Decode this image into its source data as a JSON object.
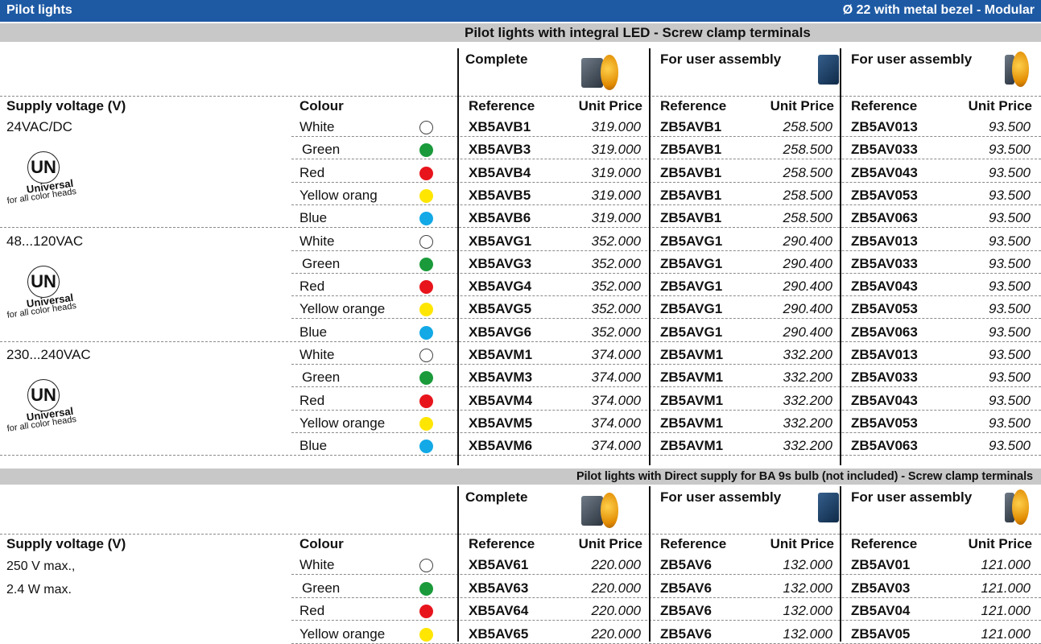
{
  "header": {
    "left": "Pilot lights",
    "right": "Ø 22 with metal bezel - Modular"
  },
  "section1": {
    "title": "Pilot lights with integral LED - Screw clamp terminals",
    "groups": [
      "Complete",
      "For user assembly",
      "For user assembly"
    ],
    "col_headers": {
      "supply": "Supply voltage (V)",
      "colour": "Colour",
      "reference": "Reference",
      "unit_price": "Unit Price"
    },
    "supply_blocks": [
      {
        "voltage": "24VAC/DC",
        "rows": [
          {
            "colour": "White",
            "dot": "#ffffff",
            "c_ref": "XB5AVB1",
            "c_price": "319.000",
            "a_ref": "ZB5AVB1",
            "a_price": "258.500",
            "b_ref": "ZB5AV013",
            "b_price": "93.500"
          },
          {
            "colour": "Green",
            "dot": "#1a9a3a",
            "c_ref": "XB5AVB3",
            "c_price": "319.000",
            "a_ref": "ZB5AVB1",
            "a_price": "258.500",
            "b_ref": "ZB5AV033",
            "b_price": "93.500"
          },
          {
            "colour": "Red",
            "dot": "#e8141c",
            "c_ref": "XB5AVB4",
            "c_price": "319.000",
            "a_ref": "ZB5AVB1",
            "a_price": "258.500",
            "b_ref": "ZB5AV043",
            "b_price": "93.500"
          },
          {
            "colour": "Yellow orang",
            "dot": "#ffe600",
            "c_ref": "XB5AVB5",
            "c_price": "319.000",
            "a_ref": "ZB5AVB1",
            "a_price": "258.500",
            "b_ref": "ZB5AV053",
            "b_price": "93.500"
          },
          {
            "colour": "Blue",
            "dot": "#12a9e6",
            "c_ref": "XB5AVB6",
            "c_price": "319.000",
            "a_ref": "ZB5AVB1",
            "a_price": "258.500",
            "b_ref": "ZB5AV063",
            "b_price": "93.500"
          }
        ]
      },
      {
        "voltage": "48...120VAC",
        "rows": [
          {
            "colour": "White",
            "dot": "#ffffff",
            "c_ref": "XB5AVG1",
            "c_price": "352.000",
            "a_ref": "ZB5AVG1",
            "a_price": "290.400",
            "b_ref": "ZB5AV013",
            "b_price": "93.500"
          },
          {
            "colour": "Green",
            "dot": "#1a9a3a",
            "c_ref": "XB5AVG3",
            "c_price": "352.000",
            "a_ref": "ZB5AVG1",
            "a_price": "290.400",
            "b_ref": "ZB5AV033",
            "b_price": "93.500"
          },
          {
            "colour": "Red",
            "dot": "#e8141c",
            "c_ref": "XB5AVG4",
            "c_price": "352.000",
            "a_ref": "ZB5AVG1",
            "a_price": "290.400",
            "b_ref": "ZB5AV043",
            "b_price": "93.500"
          },
          {
            "colour": "Yellow orange",
            "dot": "#ffe600",
            "c_ref": "XB5AVG5",
            "c_price": "352.000",
            "a_ref": "ZB5AVG1",
            "a_price": "290.400",
            "b_ref": "ZB5AV053",
            "b_price": "93.500"
          },
          {
            "colour": "Blue",
            "dot": "#12a9e6",
            "c_ref": "XB5AVG6",
            "c_price": "352.000",
            "a_ref": "ZB5AVG1",
            "a_price": "290.400",
            "b_ref": "ZB5AV063",
            "b_price": "93.500"
          }
        ]
      },
      {
        "voltage": "230...240VAC",
        "rows": [
          {
            "colour": "White",
            "dot": "#ffffff",
            "c_ref": "XB5AVM1",
            "c_price": "374.000",
            "a_ref": "ZB5AVM1",
            "a_price": "332.200",
            "b_ref": "ZB5AV013",
            "b_price": "93.500"
          },
          {
            "colour": "Green",
            "dot": "#1a9a3a",
            "c_ref": "XB5AVM3",
            "c_price": "374.000",
            "a_ref": "ZB5AVM1",
            "a_price": "332.200",
            "b_ref": "ZB5AV033",
            "b_price": "93.500"
          },
          {
            "colour": "Red",
            "dot": "#e8141c",
            "c_ref": "XB5AVM4",
            "c_price": "374.000",
            "a_ref": "ZB5AVM1",
            "a_price": "332.200",
            "b_ref": "ZB5AV043",
            "b_price": "93.500"
          },
          {
            "colour": "Yellow orange",
            "dot": "#ffe600",
            "c_ref": "XB5AVM5",
            "c_price": "374.000",
            "a_ref": "ZB5AVM1",
            "a_price": "332.200",
            "b_ref": "ZB5AV053",
            "b_price": "93.500"
          },
          {
            "colour": "Blue",
            "dot": "#12a9e6",
            "c_ref": "XB5AVM6",
            "c_price": "374.000",
            "a_ref": "ZB5AVM1",
            "a_price": "332.200",
            "b_ref": "ZB5AV063",
            "b_price": "93.500"
          }
        ]
      }
    ],
    "badge": {
      "mark": "UN",
      "line1": "Universal",
      "line2": "for all color heads"
    }
  },
  "section2": {
    "title": "Pilot lights with Direct supply for BA 9s bulb (not included) - Screw clamp terminals",
    "groups": [
      "Complete",
      "For user assembly",
      "For user assembly"
    ],
    "col_headers": {
      "supply": "Supply voltage (V)",
      "colour": "Colour",
      "reference": "Reference",
      "unit_price": "Unit Price"
    },
    "supply_lines": [
      "250 V max.,",
      "2.4 W max."
    ],
    "rows": [
      {
        "colour": "White",
        "dot": "#ffffff",
        "c_ref": "XB5AV61",
        "c_price": "220.000",
        "a_ref": "ZB5AV6",
        "a_price": "132.000",
        "b_ref": "ZB5AV01",
        "b_price": "121.000"
      },
      {
        "colour": "Green",
        "dot": "#1a9a3a",
        "c_ref": "XB5AV63",
        "c_price": "220.000",
        "a_ref": "ZB5AV6",
        "a_price": "132.000",
        "b_ref": "ZB5AV03",
        "b_price": "121.000"
      },
      {
        "colour": "Red",
        "dot": "#e8141c",
        "c_ref": "XB5AV64",
        "c_price": "220.000",
        "a_ref": "ZB5AV6",
        "a_price": "132.000",
        "b_ref": "ZB5AV04",
        "b_price": "121.000"
      },
      {
        "colour": "Yellow orange",
        "dot": "#ffe600",
        "c_ref": "XB5AV65",
        "c_price": "220.000",
        "a_ref": "ZB5AV6",
        "a_price": "132.000",
        "b_ref": "ZB5AV05",
        "b_price": "121.000"
      }
    ]
  }
}
